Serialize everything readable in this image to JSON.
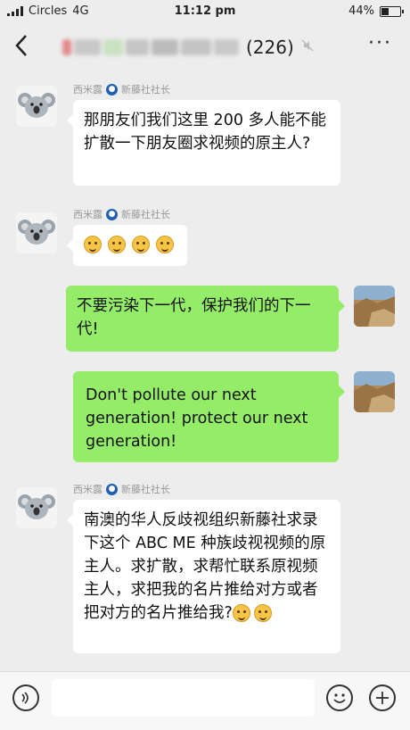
{
  "status_bar": {
    "carrier": "Circles",
    "network": "4G",
    "time": "11:12 pm",
    "battery": "44%",
    "battery_level": 0.44
  },
  "header": {
    "back_icon": "chevron-left-icon",
    "member_count": "(226)",
    "mute_icon": "mute-icon",
    "more_label": "···"
  },
  "messages": [
    {
      "sender": "西米露",
      "sender_title": "新藤社社长",
      "text": "那朋友们我们这里 200 多人能不能扩散一下朋友圈求视频的原主人?"
    },
    {
      "sender": "西米露",
      "sender_title": "新藤社社长",
      "emoji_count": 4
    },
    {
      "text": "不要污染下一代，保护我们的下一代!"
    },
    {
      "text": "Don't pollute our next generation! protect our next generation!"
    },
    {
      "sender": "西米露",
      "sender_title": "新藤社社长",
      "text": "南澳的华人反歧视组织新藤社求录下这个 ABC ME 种族歧视视频的原主人。求扩散，求帮忙联系原视频主人，求把我的名片推给对方或者把对方的名片推给我?"
    }
  ],
  "input_bar": {
    "voice_icon": "voice-icon",
    "emoji_icon": "emoji-icon",
    "plus_icon": "plus-icon",
    "input_value": ""
  },
  "colors": {
    "background": "#ededed",
    "outgoing_bubble": "#95ec69",
    "incoming_bubble": "#ffffff",
    "badge": "#1f5fb6"
  }
}
